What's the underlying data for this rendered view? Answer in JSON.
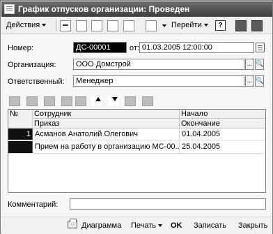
{
  "window": {
    "title": "График отпусков организации: Проведен"
  },
  "toolbar": {
    "actions_label": "Действия",
    "goto_label": "Перейти",
    "help_label": "?"
  },
  "form": {
    "number_label": "Номер:",
    "number_value": "ДС-00001",
    "from_label": "от:",
    "date_value": "01.03.2005 12:00:00",
    "organization_label": "Организация:",
    "organization_value": "ООО Домстрой",
    "responsible_label": "Ответственный:",
    "responsible_value": "Менеджер",
    "comment_label": "Комментарий:",
    "comment_value": "",
    "dots": "...",
    "search_glyph": "🔍"
  },
  "table": {
    "header": {
      "num": "№",
      "employee": "Сотрудник",
      "order": "Приказ",
      "start": "Начало",
      "end": "Окончание"
    },
    "rows": [
      {
        "num": "1",
        "employee": "Асманов Анатолий Олегович",
        "start": "01.04.2005",
        "order": "Прием на работу в организацию МС-00...",
        "end": "25.04.2005"
      }
    ]
  },
  "footer": {
    "diagram_label": "Диаграмма",
    "print_label": "Печать",
    "ok_label": "OK",
    "save_label": "Записать",
    "close_label": "Закрыть"
  }
}
